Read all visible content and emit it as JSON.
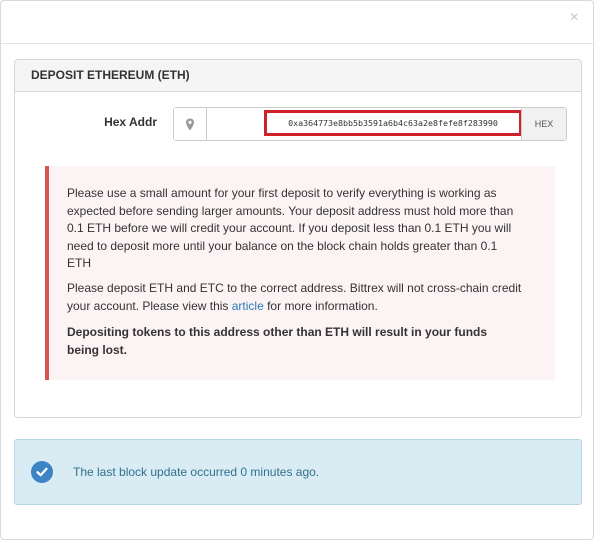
{
  "modal": {
    "close_label": "×"
  },
  "panel": {
    "title": "DEPOSIT ETHEREUM (ETH)",
    "address": {
      "label": "Hex Addr",
      "value": "0xa364773e8bb5b3591a6b4c63a2e8fefe8f283990",
      "format_button": "HEX"
    },
    "warning": {
      "paragraph1": "Please use a small amount for your first deposit to verify everything is working as expected before sending larger amounts. Your deposit address must hold more than 0.1 ETH before we will credit your account. If you deposit less than 0.1 ETH you will need to deposit more until your balance on the block chain holds greater than 0.1 ETH",
      "paragraph2_before_link": "Please deposit ETH and ETC to the correct address. Bittrex will not cross-chain credit your account. Please view this ",
      "paragraph2_link": "article",
      "paragraph2_after_link": " for more information.",
      "paragraph3": "Depositing tokens to this address other than ETH will result in your funds being lost."
    }
  },
  "status": {
    "message": "The last block update occurred 0 minutes ago."
  },
  "colors": {
    "danger": "#d9534f",
    "highlight": "#d0202a",
    "info_bg": "#d9ecf4",
    "info_text": "#31708f",
    "link": "#2a7ab8"
  },
  "icons": {
    "location": "map-marker-icon",
    "status": "check-circle-icon"
  }
}
